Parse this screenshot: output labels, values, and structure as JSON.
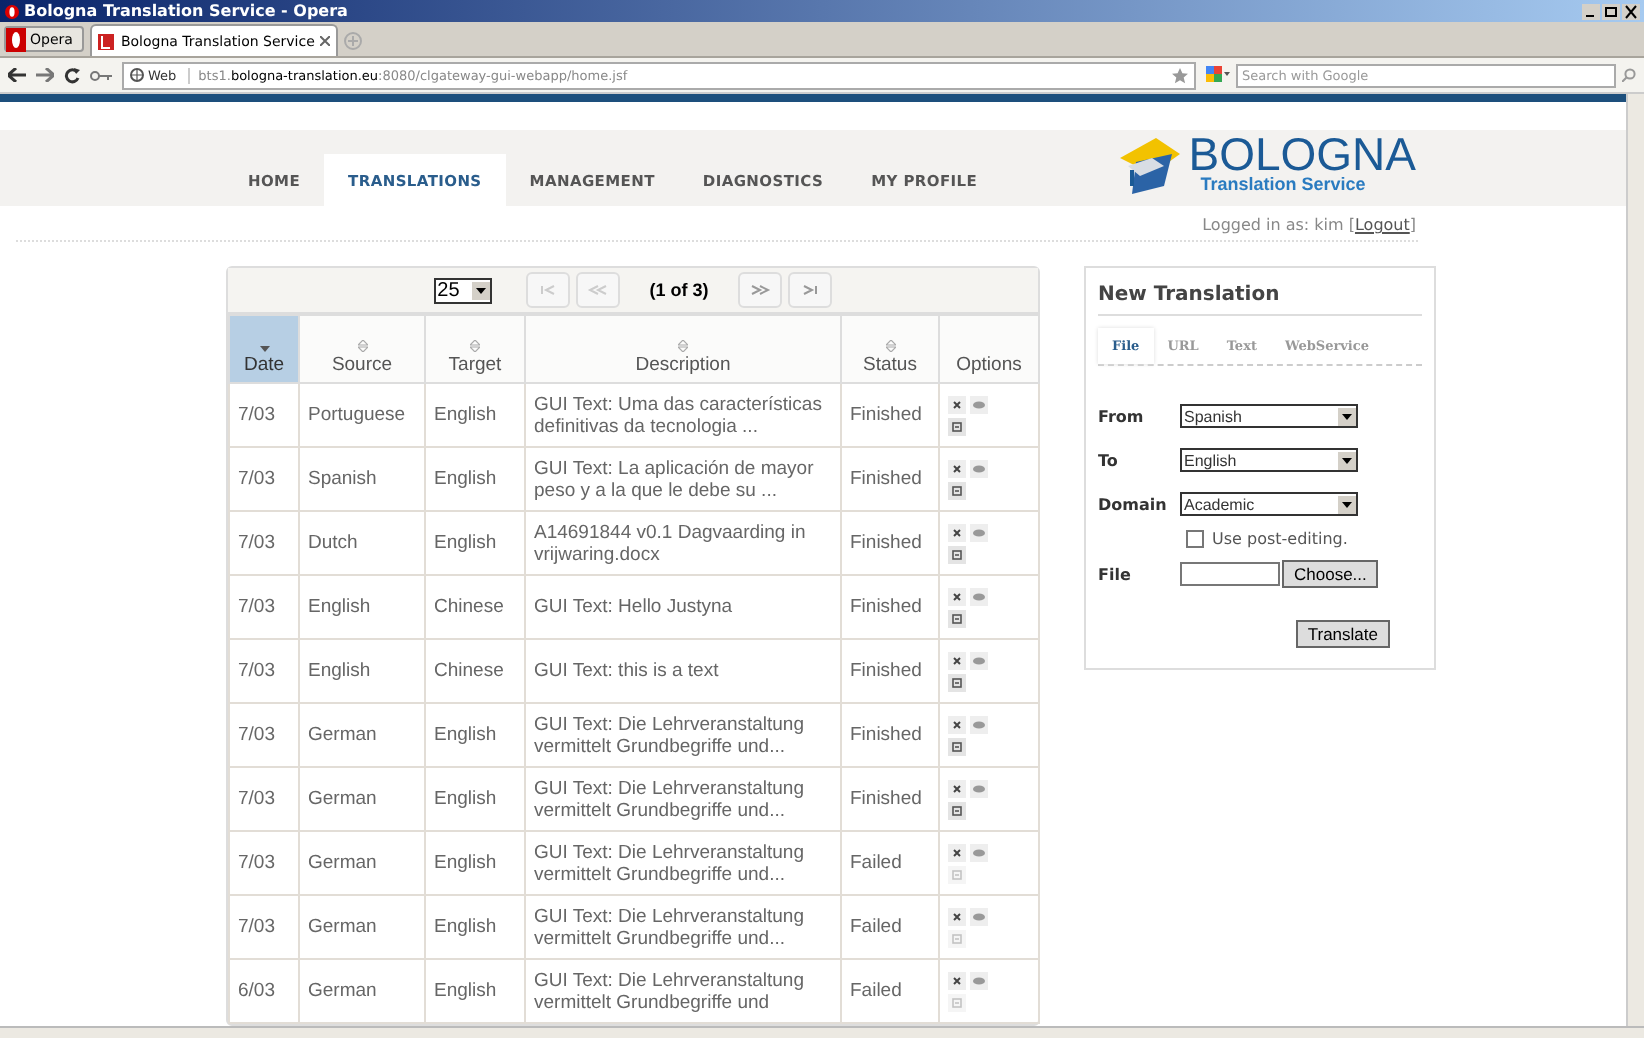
{
  "window": {
    "title": "Bologna Translation Service - Opera"
  },
  "browser": {
    "menu_button": "Opera",
    "tabs": [
      {
        "label": "Bologna Translation Service",
        "selected": true
      }
    ],
    "address": {
      "badge": "Web",
      "url": "bts1.**bologna-translation.eu**:8080/clgateway-gui-webapp/home.jsf"
    },
    "search": {
      "placeholder": "Search with Google"
    }
  },
  "nav": [
    {
      "label": "HOME",
      "selected": false
    },
    {
      "label": "TRANSLATIONS",
      "selected": true
    },
    {
      "label": "MANAGEMENT",
      "selected": false
    },
    {
      "label": "DIAGNOSTICS",
      "selected": false
    },
    {
      "label": "MY PROFILE",
      "selected": false
    }
  ],
  "logo": {
    "name": "BOLOGNA",
    "tagline": "Translation Service"
  },
  "login": {
    "text": "Logged in as: kim [",
    "link": "Logout",
    "end": "]"
  },
  "pager": {
    "page_size": "25",
    "page_info": "(1 of 3)"
  },
  "table": {
    "columns": [
      {
        "label": "Date",
        "sortable": true,
        "sorted": true
      },
      {
        "label": "Source",
        "sortable": true,
        "sorted": false
      },
      {
        "label": "Target",
        "sortable": true,
        "sorted": false
      },
      {
        "label": "Description",
        "sortable": true,
        "sorted": false
      },
      {
        "label": "Status",
        "sortable": true,
        "sorted": false
      },
      {
        "label": "Options",
        "sortable": false,
        "sorted": false
      }
    ],
    "rows": [
      {
        "date": "7/03",
        "source": "Portuguese",
        "target": "English",
        "description": "GUI Text: Uma das características definitivas da tecnologia ...",
        "status": "Finished",
        "download_enabled": true
      },
      {
        "date": "7/03",
        "source": "Spanish",
        "target": "English",
        "description": "GUI Text: La aplicación de mayor peso y a la que le debe su ...",
        "status": "Finished",
        "download_enabled": true
      },
      {
        "date": "7/03",
        "source": "Dutch",
        "target": "English",
        "description": "A14691844 v0.1 Dagvaarding in vrijwaring.docx",
        "status": "Finished",
        "download_enabled": true
      },
      {
        "date": "7/03",
        "source": "English",
        "target": "Chinese",
        "description": "GUI Text: Hello Justyna",
        "status": "Finished",
        "download_enabled": true
      },
      {
        "date": "7/03",
        "source": "English",
        "target": "Chinese",
        "description": "GUI Text: this is a text",
        "status": "Finished",
        "download_enabled": true
      },
      {
        "date": "7/03",
        "source": "German",
        "target": "English",
        "description": "GUI Text: Die Lehrveranstaltung vermittelt Grundbegriffe und...",
        "status": "Finished",
        "download_enabled": true
      },
      {
        "date": "7/03",
        "source": "German",
        "target": "English",
        "description": "GUI Text: Die Lehrveranstaltung vermittelt Grundbegriffe und...",
        "status": "Finished",
        "download_enabled": true
      },
      {
        "date": "7/03",
        "source": "German",
        "target": "English",
        "description": "GUI Text: Die Lehrveranstaltung vermittelt Grundbegriffe und...",
        "status": "Failed",
        "download_enabled": false
      },
      {
        "date": "7/03",
        "source": "German",
        "target": "English",
        "description": "GUI Text: Die Lehrveranstaltung vermittelt Grundbegriffe und...",
        "status": "Failed",
        "download_enabled": false
      },
      {
        "date": "6/03",
        "source": "German",
        "target": "English",
        "description": "GUI Text: Die Lehrveranstaltung vermittelt Grundbegriffe und",
        "status": "Failed",
        "download_enabled": false
      }
    ]
  },
  "new_translation": {
    "title": "New Translation",
    "tabs": [
      {
        "label": "File",
        "selected": true
      },
      {
        "label": "URL",
        "selected": false
      },
      {
        "label": "Text",
        "selected": false
      },
      {
        "label": "WebService",
        "selected": false
      }
    ],
    "fields": [
      {
        "label": "From",
        "value": "Spanish"
      },
      {
        "label": "To",
        "value": "English"
      },
      {
        "label": "Domain",
        "value": "Academic"
      }
    ],
    "post_editing": {
      "label": "Use post-editing.",
      "checked": false
    },
    "file": {
      "label": "File",
      "button": "Choose..."
    },
    "submit": "Translate"
  }
}
